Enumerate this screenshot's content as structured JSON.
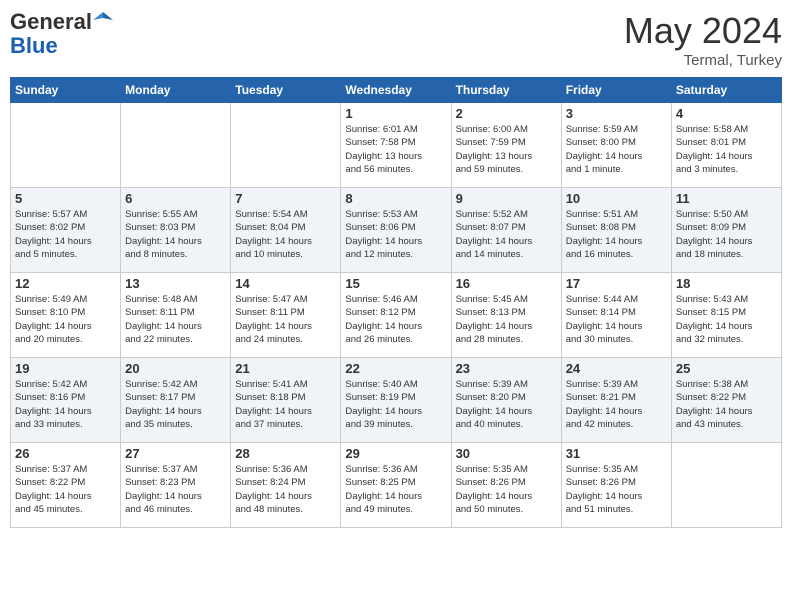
{
  "header": {
    "logo_line1": "General",
    "logo_line2": "Blue",
    "month": "May 2024",
    "location": "Termal, Turkey"
  },
  "weekdays": [
    "Sunday",
    "Monday",
    "Tuesday",
    "Wednesday",
    "Thursday",
    "Friday",
    "Saturday"
  ],
  "weeks": [
    [
      {
        "day": "",
        "info": ""
      },
      {
        "day": "",
        "info": ""
      },
      {
        "day": "",
        "info": ""
      },
      {
        "day": "1",
        "info": "Sunrise: 6:01 AM\nSunset: 7:58 PM\nDaylight: 13 hours\nand 56 minutes."
      },
      {
        "day": "2",
        "info": "Sunrise: 6:00 AM\nSunset: 7:59 PM\nDaylight: 13 hours\nand 59 minutes."
      },
      {
        "day": "3",
        "info": "Sunrise: 5:59 AM\nSunset: 8:00 PM\nDaylight: 14 hours\nand 1 minute."
      },
      {
        "day": "4",
        "info": "Sunrise: 5:58 AM\nSunset: 8:01 PM\nDaylight: 14 hours\nand 3 minutes."
      }
    ],
    [
      {
        "day": "5",
        "info": "Sunrise: 5:57 AM\nSunset: 8:02 PM\nDaylight: 14 hours\nand 5 minutes."
      },
      {
        "day": "6",
        "info": "Sunrise: 5:55 AM\nSunset: 8:03 PM\nDaylight: 14 hours\nand 8 minutes."
      },
      {
        "day": "7",
        "info": "Sunrise: 5:54 AM\nSunset: 8:04 PM\nDaylight: 14 hours\nand 10 minutes."
      },
      {
        "day": "8",
        "info": "Sunrise: 5:53 AM\nSunset: 8:06 PM\nDaylight: 14 hours\nand 12 minutes."
      },
      {
        "day": "9",
        "info": "Sunrise: 5:52 AM\nSunset: 8:07 PM\nDaylight: 14 hours\nand 14 minutes."
      },
      {
        "day": "10",
        "info": "Sunrise: 5:51 AM\nSunset: 8:08 PM\nDaylight: 14 hours\nand 16 minutes."
      },
      {
        "day": "11",
        "info": "Sunrise: 5:50 AM\nSunset: 8:09 PM\nDaylight: 14 hours\nand 18 minutes."
      }
    ],
    [
      {
        "day": "12",
        "info": "Sunrise: 5:49 AM\nSunset: 8:10 PM\nDaylight: 14 hours\nand 20 minutes."
      },
      {
        "day": "13",
        "info": "Sunrise: 5:48 AM\nSunset: 8:11 PM\nDaylight: 14 hours\nand 22 minutes."
      },
      {
        "day": "14",
        "info": "Sunrise: 5:47 AM\nSunset: 8:11 PM\nDaylight: 14 hours\nand 24 minutes."
      },
      {
        "day": "15",
        "info": "Sunrise: 5:46 AM\nSunset: 8:12 PM\nDaylight: 14 hours\nand 26 minutes."
      },
      {
        "day": "16",
        "info": "Sunrise: 5:45 AM\nSunset: 8:13 PM\nDaylight: 14 hours\nand 28 minutes."
      },
      {
        "day": "17",
        "info": "Sunrise: 5:44 AM\nSunset: 8:14 PM\nDaylight: 14 hours\nand 30 minutes."
      },
      {
        "day": "18",
        "info": "Sunrise: 5:43 AM\nSunset: 8:15 PM\nDaylight: 14 hours\nand 32 minutes."
      }
    ],
    [
      {
        "day": "19",
        "info": "Sunrise: 5:42 AM\nSunset: 8:16 PM\nDaylight: 14 hours\nand 33 minutes."
      },
      {
        "day": "20",
        "info": "Sunrise: 5:42 AM\nSunset: 8:17 PM\nDaylight: 14 hours\nand 35 minutes."
      },
      {
        "day": "21",
        "info": "Sunrise: 5:41 AM\nSunset: 8:18 PM\nDaylight: 14 hours\nand 37 minutes."
      },
      {
        "day": "22",
        "info": "Sunrise: 5:40 AM\nSunset: 8:19 PM\nDaylight: 14 hours\nand 39 minutes."
      },
      {
        "day": "23",
        "info": "Sunrise: 5:39 AM\nSunset: 8:20 PM\nDaylight: 14 hours\nand 40 minutes."
      },
      {
        "day": "24",
        "info": "Sunrise: 5:39 AM\nSunset: 8:21 PM\nDaylight: 14 hours\nand 42 minutes."
      },
      {
        "day": "25",
        "info": "Sunrise: 5:38 AM\nSunset: 8:22 PM\nDaylight: 14 hours\nand 43 minutes."
      }
    ],
    [
      {
        "day": "26",
        "info": "Sunrise: 5:37 AM\nSunset: 8:22 PM\nDaylight: 14 hours\nand 45 minutes."
      },
      {
        "day": "27",
        "info": "Sunrise: 5:37 AM\nSunset: 8:23 PM\nDaylight: 14 hours\nand 46 minutes."
      },
      {
        "day": "28",
        "info": "Sunrise: 5:36 AM\nSunset: 8:24 PM\nDaylight: 14 hours\nand 48 minutes."
      },
      {
        "day": "29",
        "info": "Sunrise: 5:36 AM\nSunset: 8:25 PM\nDaylight: 14 hours\nand 49 minutes."
      },
      {
        "day": "30",
        "info": "Sunrise: 5:35 AM\nSunset: 8:26 PM\nDaylight: 14 hours\nand 50 minutes."
      },
      {
        "day": "31",
        "info": "Sunrise: 5:35 AM\nSunset: 8:26 PM\nDaylight: 14 hours\nand 51 minutes."
      },
      {
        "day": "",
        "info": ""
      }
    ]
  ]
}
